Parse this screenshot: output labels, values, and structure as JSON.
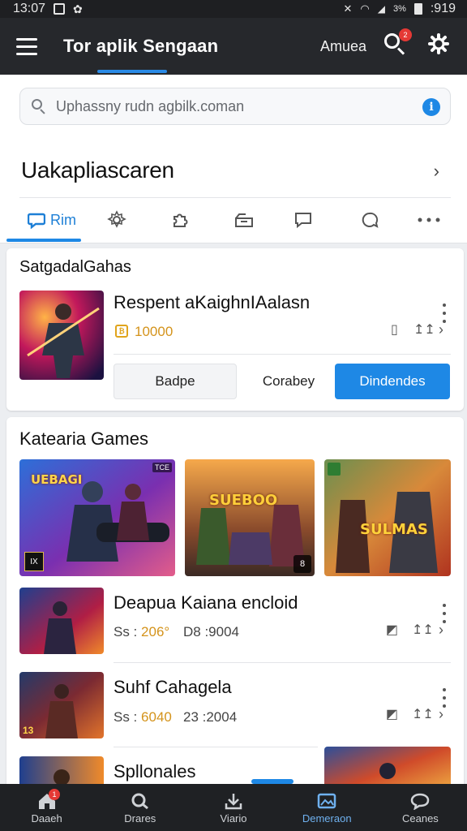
{
  "status_bar": {
    "time": "13:07",
    "right_text": "3%",
    "right_time": ":919"
  },
  "app": {
    "title": "Tor aplik Sengaan",
    "account_label": "Amuea",
    "notification_count": "2"
  },
  "search": {
    "placeholder": "Uphassny rudn agbilk.coman"
  },
  "section": {
    "heading": "Uakapliascaren"
  },
  "tabs": [
    {
      "label": "Rim",
      "icon": "chat-bubble-icon",
      "active": true
    },
    {
      "label": "",
      "icon": "gear-icon"
    },
    {
      "label": "",
      "icon": "puzzle-icon"
    },
    {
      "label": "",
      "icon": "tray-icon"
    },
    {
      "label": "",
      "icon": "comment-icon"
    },
    {
      "label": "",
      "icon": "search-chat-icon"
    },
    {
      "label": "",
      "icon": "more-icon"
    }
  ],
  "featured_card": {
    "label": "SatgadalGahas",
    "item": {
      "title": "Respent aKaighnIAalasn",
      "price": "10000"
    },
    "buttons": {
      "ghost": "Badpe",
      "plain": "Corabey",
      "primary": "Dindendes"
    }
  },
  "games_card": {
    "title": "Katearia Games",
    "tiles": [
      {
        "badge": "UEBAGI",
        "tag": "TCE",
        "corner": "IX"
      },
      {
        "badge": "SUEBOO",
        "corner": "8"
      },
      {
        "badge": "SULMAS",
        "tag": ""
      }
    ],
    "rows": [
      {
        "title": "Deapua Kaiana encloid",
        "meta_a_prefix": "Ss :",
        "meta_a_val": "206°",
        "meta_b": "D8 :9004"
      },
      {
        "title": "Suhf Cahagela",
        "meta_a_prefix": "Ss :",
        "meta_a_val": "6040",
        "meta_b": "23 :2004"
      },
      {
        "title": "Spllonales"
      }
    ]
  },
  "bottom_nav": [
    {
      "label": "Daaeh",
      "icon": "home-icon",
      "badge": "1"
    },
    {
      "label": "Drares",
      "icon": "search-icon"
    },
    {
      "label": "Viario",
      "icon": "download-icon"
    },
    {
      "label": "Demeraon",
      "icon": "gallery-icon",
      "active": true
    },
    {
      "label": "Ceanes",
      "icon": "chat-icon"
    }
  ]
}
